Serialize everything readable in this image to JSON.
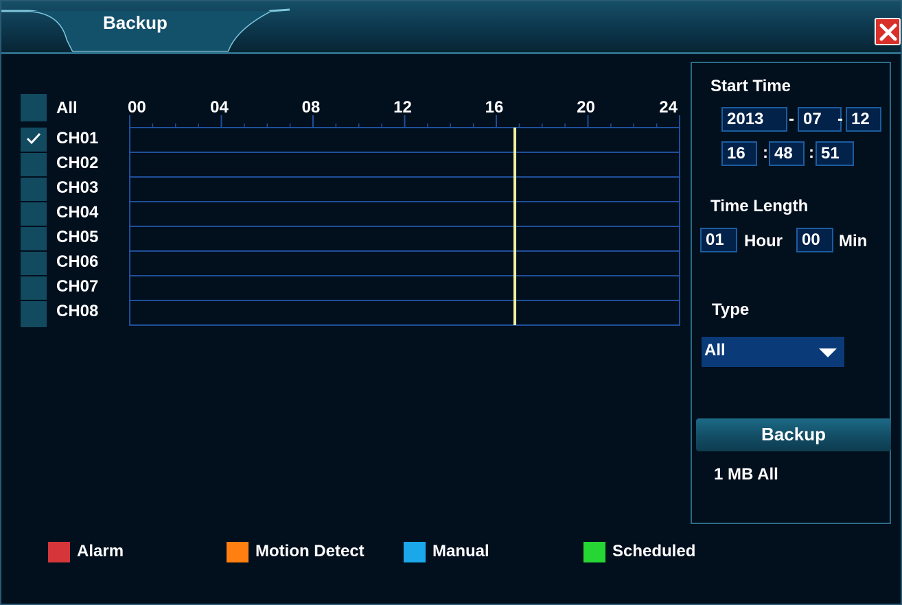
{
  "window": {
    "title": "Backup"
  },
  "colors": {
    "alarm": "#d4363a",
    "motion": "#ff8010",
    "manual": "#1aa8ea",
    "scheduled": "#26d632",
    "cursor": "#f0f0a0",
    "grid": "#1f4f9a"
  },
  "channels": {
    "all_label": "All",
    "items": [
      {
        "label": "CH01",
        "checked": true
      },
      {
        "label": "CH02",
        "checked": false
      },
      {
        "label": "CH03",
        "checked": false
      },
      {
        "label": "CH04",
        "checked": false
      },
      {
        "label": "CH05",
        "checked": false
      },
      {
        "label": "CH06",
        "checked": false
      },
      {
        "label": "CH07",
        "checked": false
      },
      {
        "label": "CH08",
        "checked": false
      }
    ]
  },
  "timeline": {
    "hour_labels": [
      "00",
      "04",
      "08",
      "12",
      "16",
      "20",
      "24"
    ],
    "cursor_hour": 16.81
  },
  "start_time": {
    "label": "Start Time",
    "year": "2013",
    "month": "07",
    "day": "12",
    "hour": "16",
    "minute": "48",
    "second": "51",
    "date_sep": "-",
    "time_sep": ":"
  },
  "time_length": {
    "label": "Time Length",
    "hours": "01",
    "hour_unit": "Hour",
    "minutes": "00",
    "min_unit": "Min"
  },
  "type": {
    "label": "Type",
    "selected": "All"
  },
  "backup_button": {
    "label": "Backup"
  },
  "backup_size": "1 MB All",
  "legend": {
    "alarm": "Alarm",
    "motion": "Motion Detect",
    "manual": "Manual",
    "scheduled": "Scheduled"
  }
}
